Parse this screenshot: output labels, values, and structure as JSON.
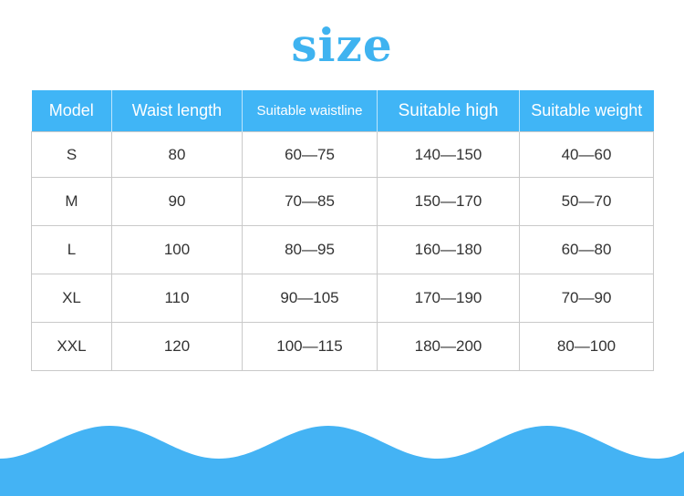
{
  "title": "size",
  "colors": {
    "accent": "#40b5f6",
    "title": "#3fb3f0",
    "border": "#c9c9c9",
    "text": "#333333",
    "wave": "#44b3f4"
  },
  "table": {
    "headers": [
      "Model",
      "Waist length",
      "Suitable waistline",
      "Suitable high",
      "Suitable weight"
    ],
    "rows": [
      [
        "S",
        "80",
        "60—75",
        "140—150",
        "40—60"
      ],
      [
        "M",
        "90",
        "70—85",
        "150—170",
        "50—70"
      ],
      [
        "L",
        "100",
        "80—95",
        "160—180",
        "60—80"
      ],
      [
        "XL",
        "110",
        "90—105",
        "170—190",
        "70—90"
      ],
      [
        "XXL",
        "120",
        "100—115",
        "180—200",
        "80—100"
      ]
    ]
  }
}
